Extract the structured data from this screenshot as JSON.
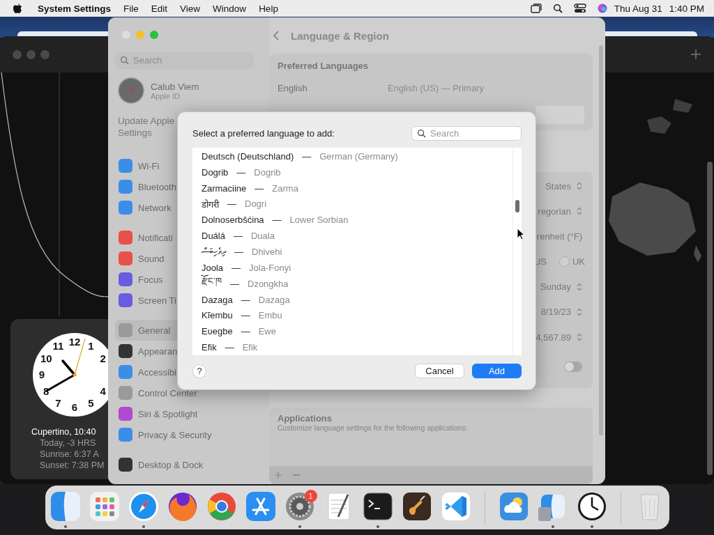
{
  "menu_bar": {
    "app": "System Settings",
    "menus": [
      "File",
      "Edit",
      "View",
      "Window",
      "Help"
    ],
    "date": "Thu Aug 31",
    "time": "1:40 PM"
  },
  "world_clock": {
    "dial": [
      "11",
      "12",
      "1",
      "10",
      "2",
      "9",
      "8",
      "4",
      "7",
      "6",
      "5"
    ],
    "lines": [
      "Cupertino, 10:40",
      "Today, -3 HRS",
      "Sunrise: 6:37 A",
      "Sunset: 7:38 PM"
    ]
  },
  "settings": {
    "title": "Language & Region",
    "search_placeholder": "Search",
    "account": {
      "name": "Calub Viem",
      "subtitle": "Apple ID"
    },
    "notice": [
      "Update Apple",
      "Settings"
    ],
    "sidebar_groups": [
      {
        "items": [
          {
            "label": "Wi-Fi",
            "color": "#3b8ee8",
            "selected": false
          },
          {
            "label": "Bluetooth",
            "color": "#3b8ee8",
            "selected": false
          },
          {
            "label": "Network",
            "color": "#3b8ee8",
            "selected": false
          }
        ]
      },
      {
        "items": [
          {
            "label": "Notificati",
            "color": "#e8504a",
            "selected": false
          },
          {
            "label": "Sound",
            "color": "#e8504a",
            "selected": false
          },
          {
            "label": "Focus",
            "color": "#6a5ce0",
            "selected": false
          },
          {
            "label": "Screen Ti",
            "color": "#6a5ce0",
            "selected": false
          }
        ]
      },
      {
        "items": [
          {
            "label": "General",
            "color": "#9a9a9a",
            "selected": true
          },
          {
            "label": "Appearan",
            "color": "#333333",
            "selected": false
          },
          {
            "label": "Accessibi",
            "color": "#3b8ee8",
            "selected": false
          },
          {
            "label": "Control Center",
            "color": "#9a9a9a",
            "selected": false
          },
          {
            "label": "Siri & Spotlight",
            "color": "#b04ad0",
            "selected": false
          },
          {
            "label": "Privacy & Security",
            "color": "#3b8ee8",
            "selected": false
          }
        ]
      },
      {
        "items": [
          {
            "label": "Desktop & Dock",
            "color": "#333333",
            "selected": false
          }
        ]
      }
    ],
    "preferred_languages": {
      "heading": "Preferred Languages",
      "language": "English",
      "detail": "English (US) — Primary"
    },
    "rows": [
      {
        "kind": "popup",
        "value": "States"
      },
      {
        "kind": "popup",
        "value": "regorian"
      },
      {
        "kind": "text",
        "value": "renheit (°F)"
      },
      {
        "kind": "radio",
        "options": [
          {
            "label": "US"
          },
          {
            "label": "UK",
            "selected": false
          }
        ]
      },
      {
        "kind": "popup",
        "value": "Sunday"
      },
      {
        "kind": "popup",
        "value": "8/19/23"
      },
      {
        "kind": "popup",
        "value": "4,567.89"
      },
      {
        "kind": "toggle",
        "on": false
      }
    ],
    "applications": {
      "heading": "Applications",
      "description": "Customize language settings for the following applications:"
    }
  },
  "dialog": {
    "prompt": "Select a preferred language to add:",
    "search_placeholder": "Search",
    "languages": [
      {
        "native": "Deutsch (Deutschland)",
        "separator": "—",
        "english": "German (Germany)"
      },
      {
        "native": "Dogrib",
        "separator": "—",
        "english": "Dogrib"
      },
      {
        "native": "Zarmaciine",
        "separator": "—",
        "english": "Zarma"
      },
      {
        "native": "डोगरी",
        "separator": "—",
        "english": "Dogri"
      },
      {
        "native": "Dolnoserbšćina",
        "separator": "—",
        "english": "Lower Sorbian"
      },
      {
        "native": "Duálá",
        "separator": "—",
        "english": "Duala"
      },
      {
        "native": "ދިވެހިބަސް",
        "separator": "—",
        "english": "Dhivehi"
      },
      {
        "native": "Joola",
        "separator": "—",
        "english": "Jola-Fonyi"
      },
      {
        "native": "རྫོང་ཁ",
        "separator": "—",
        "english": "Dzongkha"
      },
      {
        "native": "Dazaga",
        "separator": "—",
        "english": "Dazaga"
      },
      {
        "native": "Kĩembu",
        "separator": "—",
        "english": "Embu"
      },
      {
        "native": "Eʋegbe",
        "separator": "—",
        "english": "Ewe"
      },
      {
        "native": "Efik",
        "separator": "—",
        "english": "Efik"
      }
    ],
    "help": "?",
    "buttons": [
      {
        "label": "Cancel",
        "default": false
      },
      {
        "label": "Add",
        "default": true
      }
    ]
  },
  "dock": {
    "groups": [
      {
        "items": [
          {
            "running": true
          },
          {
            "running": false
          },
          {
            "running": true
          },
          {
            "running": false
          },
          {
            "running": false
          },
          {
            "running": false
          },
          {
            "running": true,
            "badge": "1"
          },
          {
            "running": false
          },
          {
            "running": true
          },
          {
            "running": false
          },
          {
            "running": false
          }
        ]
      },
      {
        "items": [
          {
            "running": false
          },
          {
            "running": true
          },
          {
            "running": true
          }
        ]
      },
      {
        "items": [
          {
            "running": false
          }
        ]
      }
    ]
  }
}
